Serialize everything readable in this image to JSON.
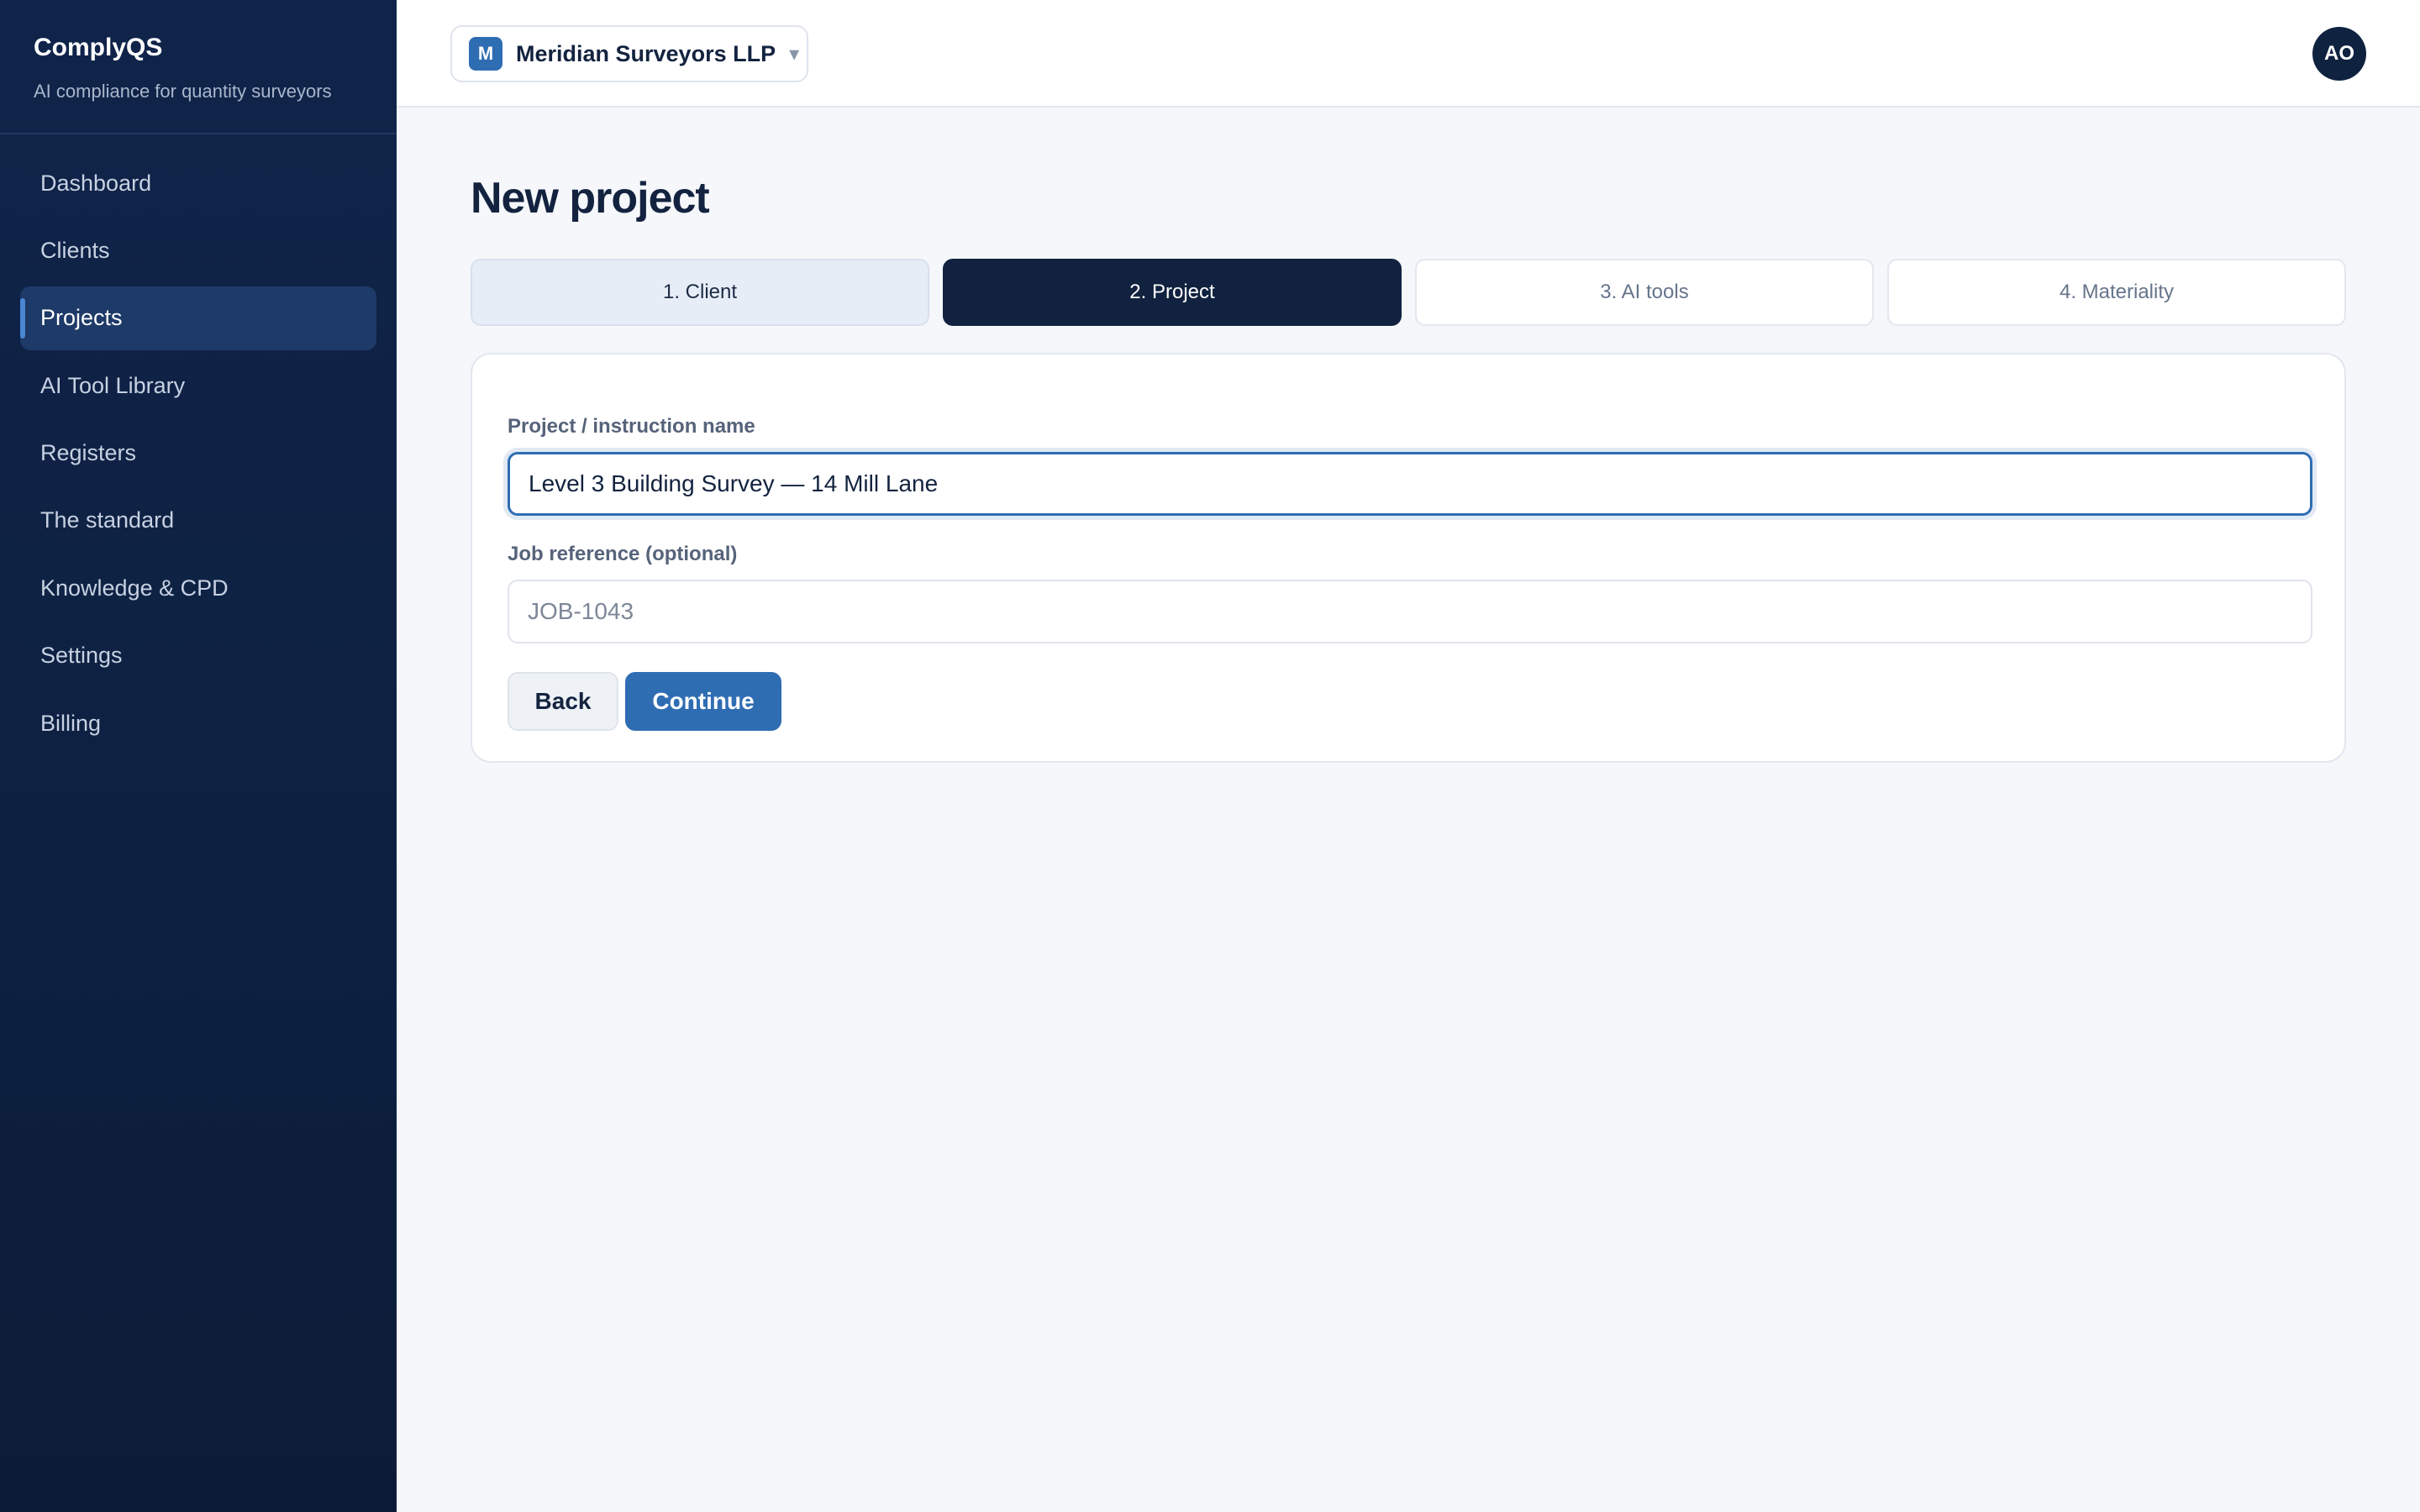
{
  "app": {
    "name": "ComplyQS",
    "tagline": "AI compliance for quantity surveyors"
  },
  "sidebar": {
    "items": [
      {
        "label": "Dashboard"
      },
      {
        "label": "Clients"
      },
      {
        "label": "Projects",
        "active": true
      },
      {
        "label": "AI Tool Library"
      },
      {
        "label": "Registers"
      },
      {
        "label": "The standard"
      },
      {
        "label": "Knowledge & CPD"
      },
      {
        "label": "Settings"
      },
      {
        "label": "Billing"
      }
    ]
  },
  "header": {
    "org_badge": "M",
    "org_name": "Meridian Surveyors LLP",
    "org_chevron": "▾",
    "avatar_initials": "AO"
  },
  "main": {
    "title": "New project",
    "steps": [
      {
        "label": "1. Client",
        "state": "done"
      },
      {
        "label": "2. Project",
        "state": "current"
      },
      {
        "label": "3. AI tools",
        "state": "upcoming"
      },
      {
        "label": "4. Materiality",
        "state": "upcoming"
      }
    ],
    "form": {
      "name_label": "Project / instruction name",
      "name_value": "Level 3 Building Survey — 14 Mill Lane",
      "ref_label": "Job reference (optional)",
      "ref_placeholder": "JOB-1043",
      "back_label": "Back",
      "continue_label": "Continue"
    }
  },
  "colors": {
    "sidebar_bg": "#10244a",
    "accent": "#2f6db3",
    "step_current": "#10223f"
  }
}
